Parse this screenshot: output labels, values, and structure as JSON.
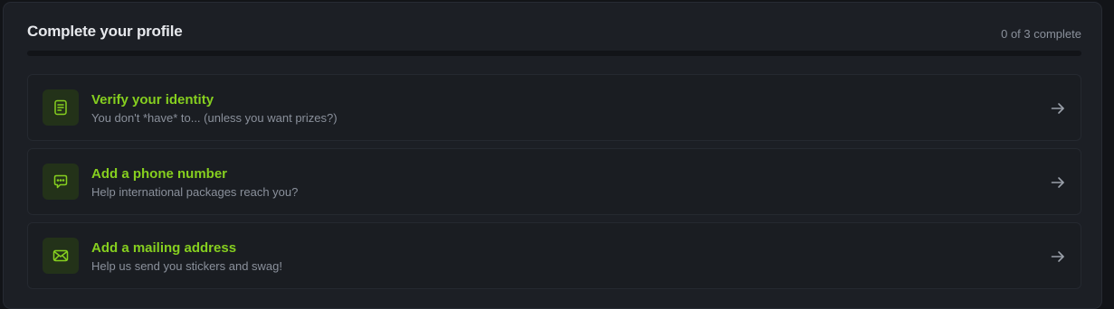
{
  "profile": {
    "title": "Complete your profile",
    "progress_text": "0 of 3 complete",
    "progress_fraction": 0,
    "accent_color": "#86cf1f"
  },
  "tasks": [
    {
      "title": "Verify your identity",
      "description": "You don't *have* to... (unless you want prizes?)",
      "icon": "document-icon"
    },
    {
      "title": "Add a phone number",
      "description": "Help international packages reach you?",
      "icon": "chat-bubble-icon"
    },
    {
      "title": "Add a mailing address",
      "description": "Help us send you stickers and swag!",
      "icon": "envelope-icon"
    }
  ]
}
